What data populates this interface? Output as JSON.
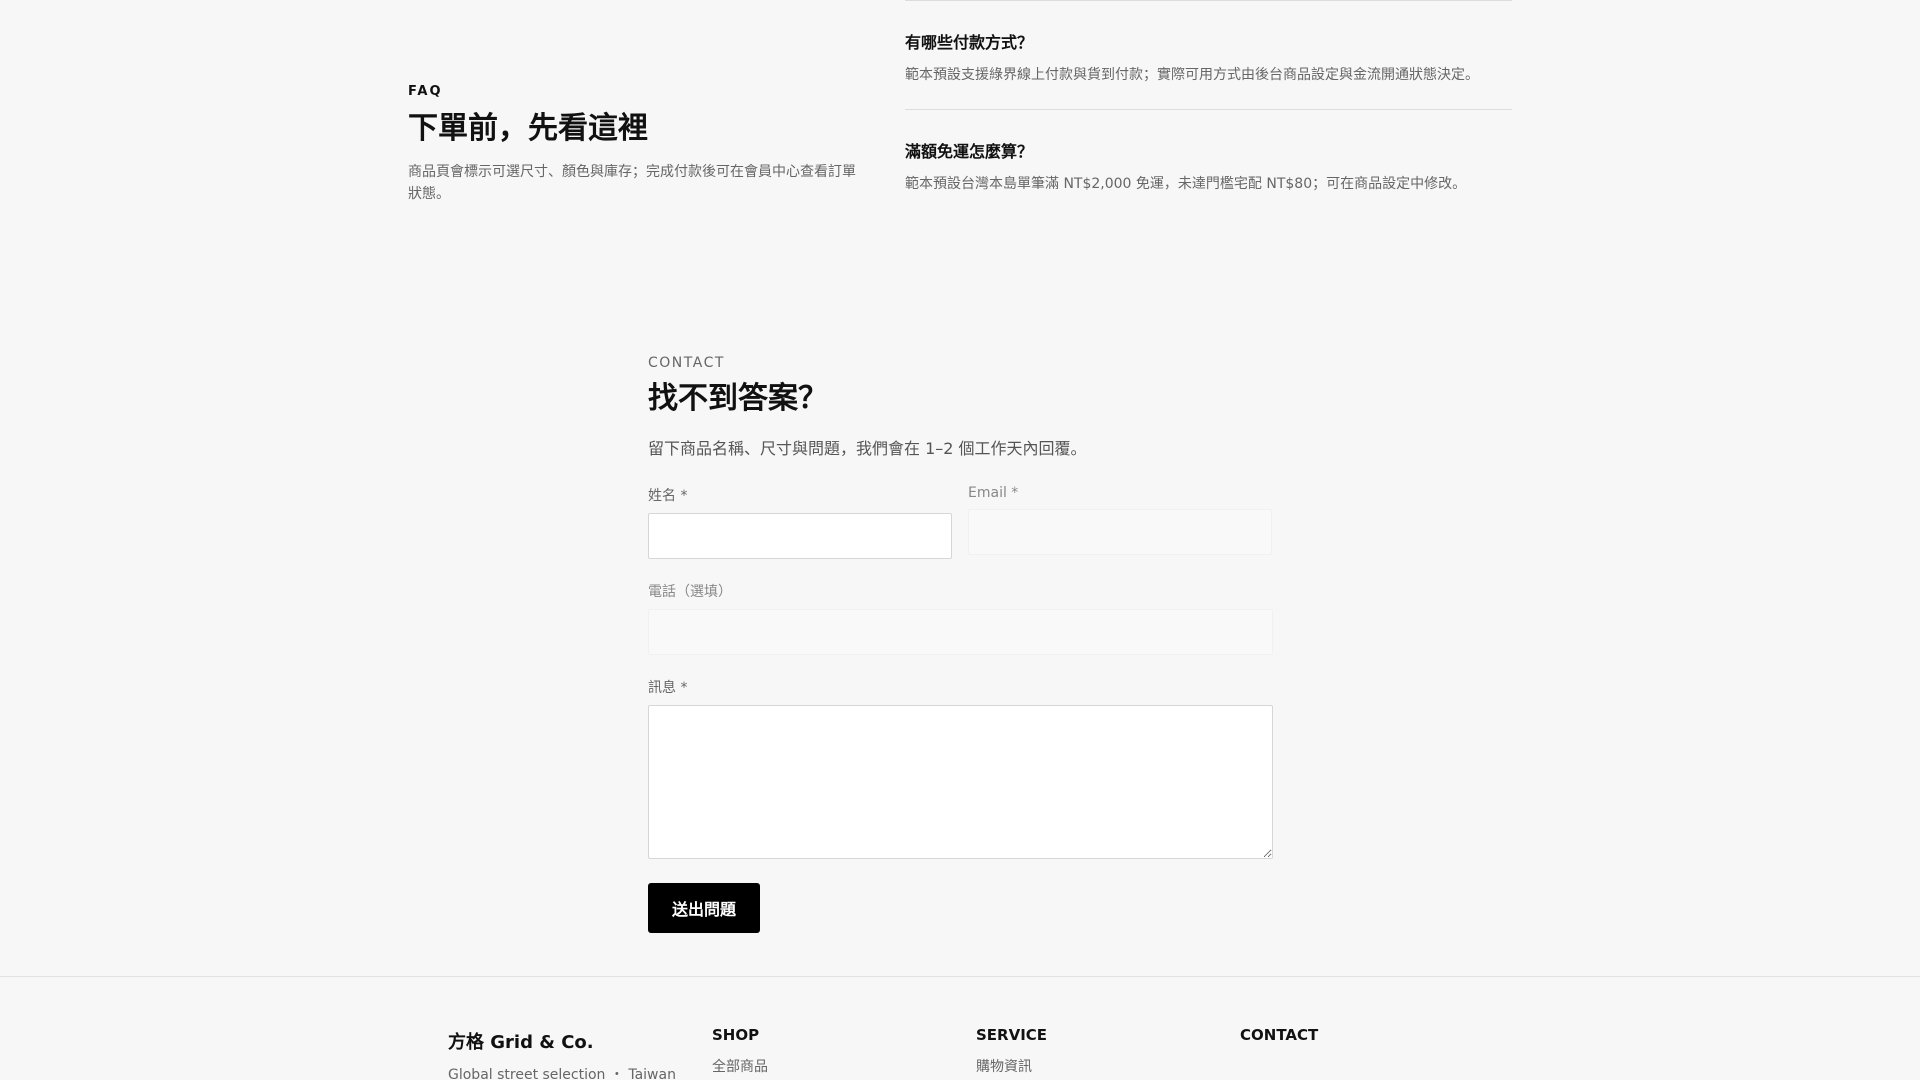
{
  "faq": {
    "eyebrow": "FAQ",
    "title": "下單前，先看這裡",
    "description": "商品頁會標示可選尺寸、顏色與庫存；完成付款後可在會員中心查看訂單狀態。",
    "items": [
      {
        "question": "有哪些付款方式？",
        "answer": "範本預設支援綠界線上付款與貨到付款；實際可用方式由後台商品設定與金流開通狀態決定。"
      },
      {
        "question": "滿額免運怎麼算？",
        "answer": "範本預設台灣本島單筆滿 NT$2,000 免運，未達門檻宅配 NT$80；可在商品設定中修改。"
      }
    ]
  },
  "contact": {
    "eyebrow": "CONTACT",
    "title": "找不到答案？",
    "description": "留下商品名稱、尺寸與問題，我們會在 1–2 個工作天內回覆。",
    "fields": {
      "name_label": "姓名 *",
      "email_label": "Email *",
      "phone_label": "電話（選填）",
      "message_label": "訊息 *"
    },
    "submit_label": "送出問題"
  },
  "footer": {
    "brand": "方格 Grid & Co.",
    "tagline": "Global street selection ・ Taiwan",
    "columns": [
      {
        "title": "SHOP",
        "first_link": "全部商品"
      },
      {
        "title": "SERVICE",
        "first_link": "購物資訊"
      },
      {
        "title": "CONTACT",
        "first_link": ""
      }
    ]
  }
}
